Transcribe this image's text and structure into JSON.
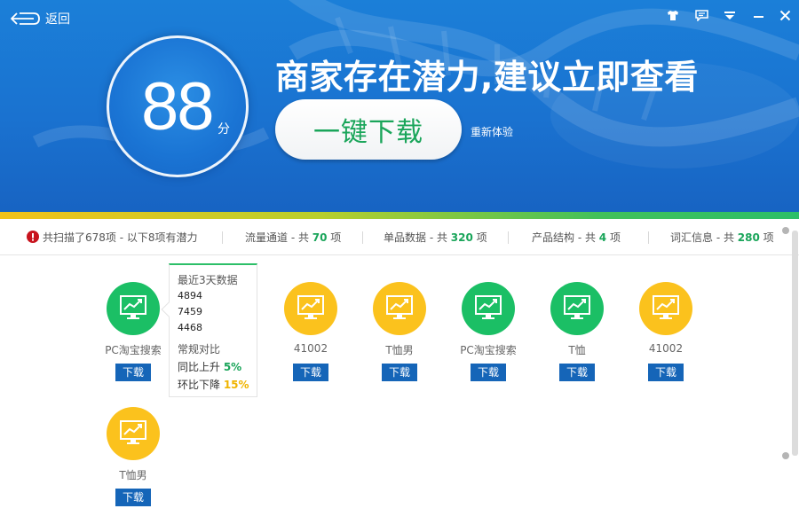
{
  "header": {
    "back_label": "返回",
    "score": "88",
    "score_unit": "分",
    "headline": "商家存在潜力,建议立即查看",
    "download_button": "一键下载",
    "retry_label": "重新体验"
  },
  "colors": {
    "banner_blue": "#1a72d0",
    "accent_green": "#1aa55a",
    "accent_yellow": "#fbc21d",
    "button_blue": "#1565b8"
  },
  "stats": {
    "scan": {
      "prefix": "共扫描了",
      "count": "678",
      "middle": "项 - 以下",
      "potential": "8",
      "suffix": "项有潜力"
    },
    "items": [
      {
        "label": "流量通道 - 共 ",
        "count": "70",
        "unit": " 项"
      },
      {
        "label": "单品数据 - 共 ",
        "count": "320",
        "unit": " 项"
      },
      {
        "label": "产品结构 - 共 ",
        "count": "4",
        "unit": " 项"
      },
      {
        "label": "词汇信息 - 共 ",
        "count": "280",
        "unit": " 项"
      }
    ]
  },
  "grid": {
    "download_label": "下载",
    "items": [
      {
        "name": "PC淘宝搜索",
        "color": "green",
        "icon": "trend-chart-icon"
      },
      {
        "name": "41002",
        "color": "yellow",
        "icon": "trend-chart-icon"
      },
      {
        "name": "T恤男",
        "color": "yellow",
        "icon": "trend-chart-icon"
      },
      {
        "name": "PC淘宝搜索",
        "color": "green",
        "icon": "trend-chart-icon"
      },
      {
        "name": "T恤",
        "color": "green",
        "icon": "trend-chart-icon"
      },
      {
        "name": "41002",
        "color": "yellow",
        "icon": "trend-chart-icon"
      },
      {
        "name": "T恤男",
        "color": "yellow",
        "icon": "trend-chart-icon"
      }
    ]
  },
  "tooltip": {
    "title": "最近3天数据",
    "values": [
      "4894",
      "7459",
      "4468"
    ],
    "compare_title": "常规对比",
    "yoy_label": "同比上升 ",
    "yoy_value": "5%",
    "mom_label": "环比下降 ",
    "mom_value": "15%"
  },
  "window_controls": [
    "skin-icon",
    "message-icon",
    "menu-icon",
    "minimize-icon",
    "close-icon"
  ]
}
